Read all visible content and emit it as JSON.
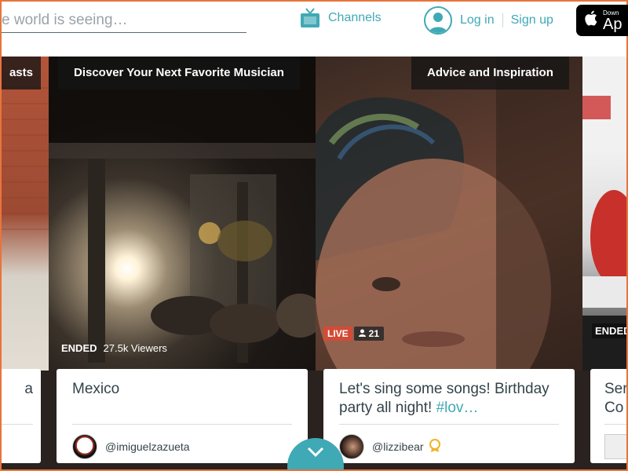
{
  "header": {
    "search_text": "e world is seeing…",
    "channels_label": "Channels",
    "login_label": "Log in",
    "signup_label": "Sign up",
    "appstore_small": "Down",
    "appstore_big": "Ap"
  },
  "cards": [
    {
      "category": "asts",
      "status": "",
      "title": "a",
      "user": ""
    },
    {
      "category": "Discover Your Next Favorite Musician",
      "status": "ENDED",
      "viewers": "27.5k Viewers",
      "title": "Mexico",
      "user": "@imiguelzazueta"
    },
    {
      "category": "Advice and Inspiration",
      "live_label": "LIVE",
      "viewer_count": "21",
      "title_main": "Let's sing some songs! Birthday party all night! ",
      "title_hash": "#lov…",
      "user": "@lizzibear"
    },
    {
      "category": "",
      "status": "ENDED",
      "title": "Ser Co",
      "user": ""
    }
  ],
  "colors": {
    "accent": "#3fa9b5",
    "live": "#d34b36",
    "frame": "#e8743b"
  },
  "icons": [
    "tv-icon",
    "avatar-icon",
    "apple-icon",
    "user-icon",
    "award-icon",
    "chevron-down-icon"
  ]
}
